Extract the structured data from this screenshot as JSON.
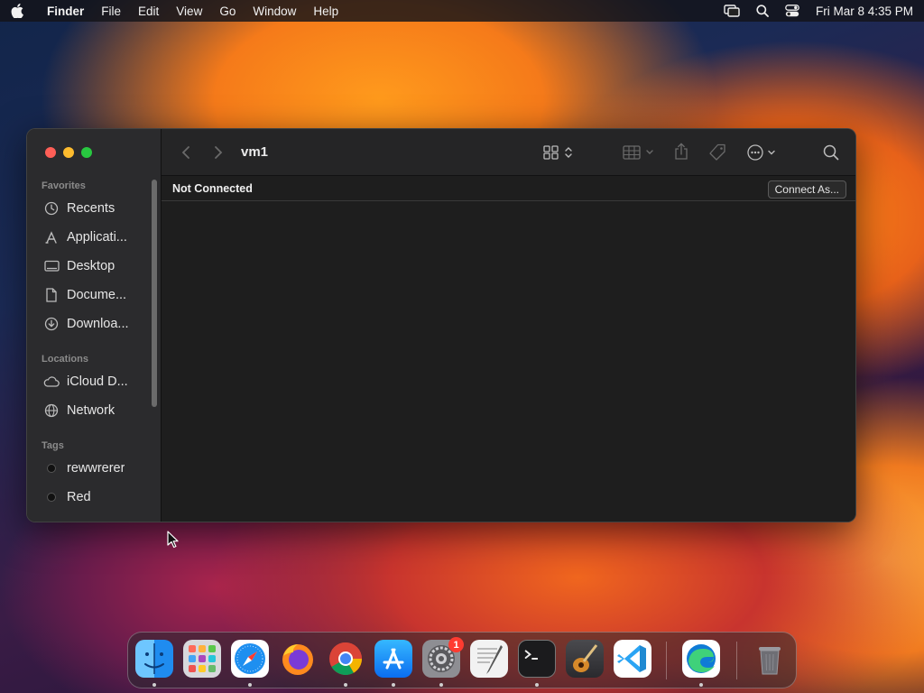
{
  "menubar": {
    "app_name": "Finder",
    "items": [
      "File",
      "Edit",
      "View",
      "Go",
      "Window",
      "Help"
    ],
    "clock": "Fri Mar 8  4:35 PM"
  },
  "window": {
    "title": "vm1",
    "status": "Not Connected",
    "connect_label": "Connect As..."
  },
  "sidebar": {
    "favorites_header": "Favorites",
    "favorites": [
      {
        "label": "Recents",
        "icon": "clock-icon"
      },
      {
        "label": "Applicati...",
        "icon": "applications-icon"
      },
      {
        "label": "Desktop",
        "icon": "desktop-icon"
      },
      {
        "label": "Docume...",
        "icon": "document-icon"
      },
      {
        "label": "Downloa...",
        "icon": "download-icon"
      }
    ],
    "locations_header": "Locations",
    "locations": [
      {
        "label": "iCloud D...",
        "icon": "cloud-icon"
      },
      {
        "label": "Network",
        "icon": "globe-icon"
      }
    ],
    "tags_header": "Tags",
    "tags": [
      {
        "label": "rewwrerer",
        "color": "#111111"
      },
      {
        "label": "Red",
        "color": "#111111"
      }
    ]
  },
  "dock": {
    "apps": [
      "Finder",
      "Launchpad",
      "Safari",
      "Firefox",
      "Chrome",
      "App Store",
      "System Settings",
      "TextEdit",
      "Terminal",
      "GarageBand",
      "VS Code",
      "Edge",
      "Trash"
    ],
    "settings_badge": "1"
  },
  "colors": {
    "traffic_red": "#ff5f57",
    "traffic_yellow": "#febc2e",
    "traffic_green": "#28c840",
    "badge": "#ff3b30"
  }
}
